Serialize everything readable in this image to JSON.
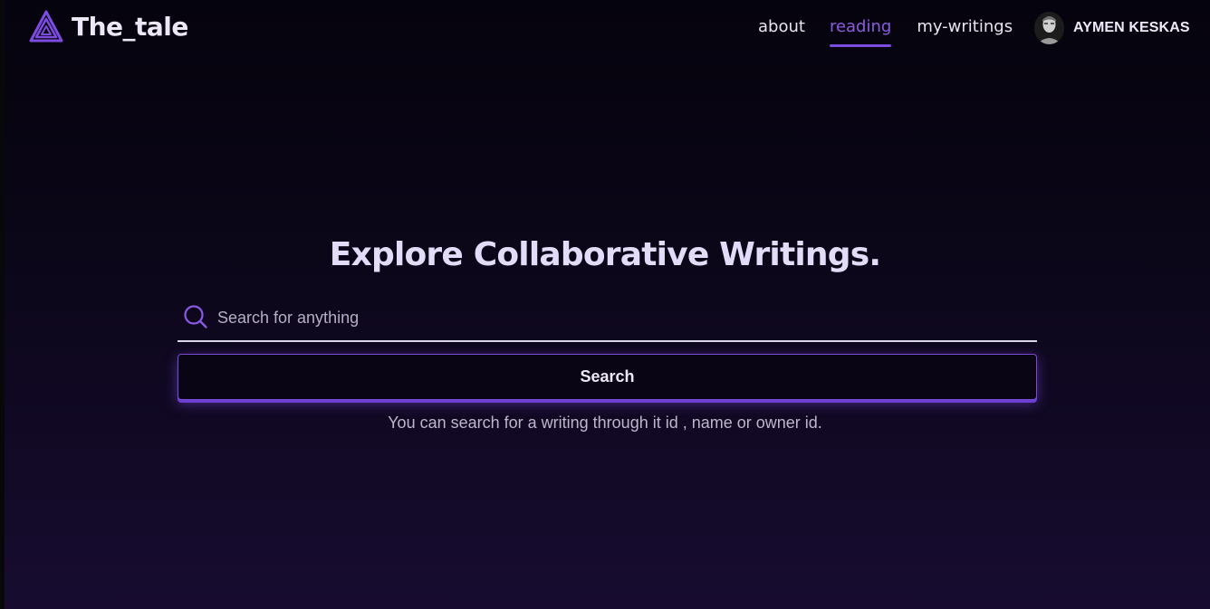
{
  "brand": {
    "name": "The_tale",
    "logo_icon": "triangle-logo-icon"
  },
  "nav": {
    "items": [
      {
        "label": "about",
        "active": false
      },
      {
        "label": "reading",
        "active": true
      },
      {
        "label": "my-writings",
        "active": false
      }
    ]
  },
  "user": {
    "name": "AYMEN KESKAS",
    "avatar_icon": "avatar"
  },
  "main": {
    "title": "Explore Collaborative Writings.",
    "search": {
      "placeholder": "Search for anything",
      "value": "",
      "icon": "search-icon"
    },
    "search_button_label": "Search",
    "hint": "You can search for a writing through it id , name or owner id."
  },
  "colors": {
    "accent": "#7c4ce0",
    "background_top": "#05030d",
    "background_bottom": "#170c30",
    "text": "#e6e0f5"
  }
}
